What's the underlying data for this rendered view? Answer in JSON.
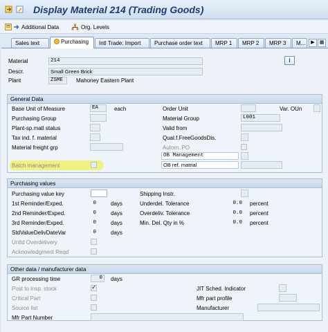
{
  "window": {
    "title": "Display Material 214 (Trading Goods)"
  },
  "toolbar": {
    "additional_data": "Additional Data",
    "org_levels": "Org. Levels"
  },
  "tabs": [
    "Sales text",
    "Purchasing",
    "Intl Trade: Import",
    "Purchase order text",
    "MRP 1",
    "MRP 2",
    "MRP 3",
    "M..."
  ],
  "header": {
    "material_label": "Material",
    "material_value": "214",
    "descr_label": "Descr.",
    "descr_value": "Small Green Brick",
    "plant_label": "Plant",
    "plant_code": "ZSME",
    "plant_name": "Mahoney Eastern Plant"
  },
  "general": {
    "title": "General Data",
    "base_uom_label": "Base Unit of Measure",
    "base_uom_value": "EA",
    "base_uom_text": "each",
    "order_unit_label": "Order Unit",
    "var_oun_label": "Var. OUn",
    "purch_group_label": "Purchasing Group",
    "material_group_label": "Material Group",
    "material_group_value": "L001",
    "plant_sp_label": "Plant-sp.matl status",
    "valid_from_label": "Valid from",
    "tax_label": "Tax ind. f. material",
    "qual_label": "Qual.f.FreeGoodsDis.",
    "freight_label": "Material freight grp",
    "autom_po_label": "Autom. PO",
    "ob_mgmt_label": "OB Management",
    "batch_label": "Batch management",
    "ob_ref_label": "OB ref. matrial"
  },
  "purchasing": {
    "title": "Purchasing values",
    "pvk_label": "Purchasing value key",
    "shipping_label": "Shipping Instr.",
    "r1_label": "1st Reminder/Exped.",
    "r1_value": "0",
    "r1_unit": "days",
    "under_label": "Underdel. Tolerance",
    "under_value": "0.0",
    "under_unit": "percent",
    "r2_label": "2nd Reminder/Exped.",
    "r2_value": "0",
    "r2_unit": "days",
    "over_label": "Overdeliv. Tolerance",
    "over_value": "0.0",
    "over_unit": "percent",
    "r3_label": "3rd Reminder/Exped.",
    "r3_value": "0",
    "r3_unit": "days",
    "min_label": "Min. Del. Qty in %",
    "min_value": "0.0",
    "min_unit": "percent",
    "std_label": "StdValueDelivDateVar",
    "std_value": "0",
    "std_unit": "days",
    "unltd_label": "Unltd Overdelivery",
    "ack_label": "Acknowledgment Reqd"
  },
  "other": {
    "title": "Other data / manufacturer data",
    "gr_label": "GR processing time",
    "gr_value": "0",
    "gr_unit": "days",
    "post_label": "Post to insp. stock",
    "jit_label": "JIT Sched. Indicator",
    "critical_label": "Critical Part",
    "mfr_profile_label": "Mfr part profile",
    "source_label": "Source list",
    "manufacturer_label": "Manufacturer",
    "mfr_part_label": "Mfr Part Number"
  },
  "icons": {
    "info": "i",
    "additional_data_icon": "arrow-right-icon",
    "org_levels_icon": "org-hierarchy-icon"
  },
  "colors": {
    "title": "#1b3d73",
    "highlight": "#eef06b",
    "panel": "#edf2f8"
  }
}
